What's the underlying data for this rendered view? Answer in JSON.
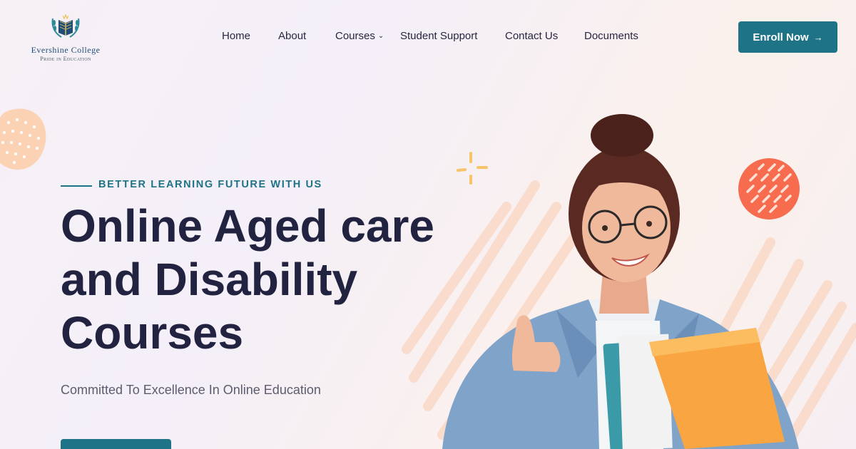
{
  "brand": {
    "name": "Evershine College",
    "tagline": "Pride in Education",
    "logo_icon": "open-book-laurel-icon"
  },
  "nav": {
    "items": [
      {
        "label": "Home"
      },
      {
        "label": "About"
      },
      {
        "label": "Courses",
        "has_dropdown": true
      },
      {
        "label": "Student Support"
      },
      {
        "label": "Contact Us"
      },
      {
        "label": "Documents"
      }
    ],
    "dropdown_icon": "chevron-down-icon"
  },
  "header_cta": {
    "label": "Enroll Now",
    "icon": "arrow-right-icon"
  },
  "hero": {
    "eyebrow": "BETTER LEARNING FUTURE WITH US",
    "title_lines": [
      "Online Aged care",
      "and Disability",
      "Courses"
    ],
    "subtitle": "Committed To Excellence In Online Education",
    "image": "student-holding-folders-thumbs-up"
  },
  "colors": {
    "primary": "#1e7386",
    "heading": "#222241",
    "accent_orange": "#f76b4f",
    "accent_peach": "#fbd3b4",
    "accent_gold": "#f7c46a"
  }
}
